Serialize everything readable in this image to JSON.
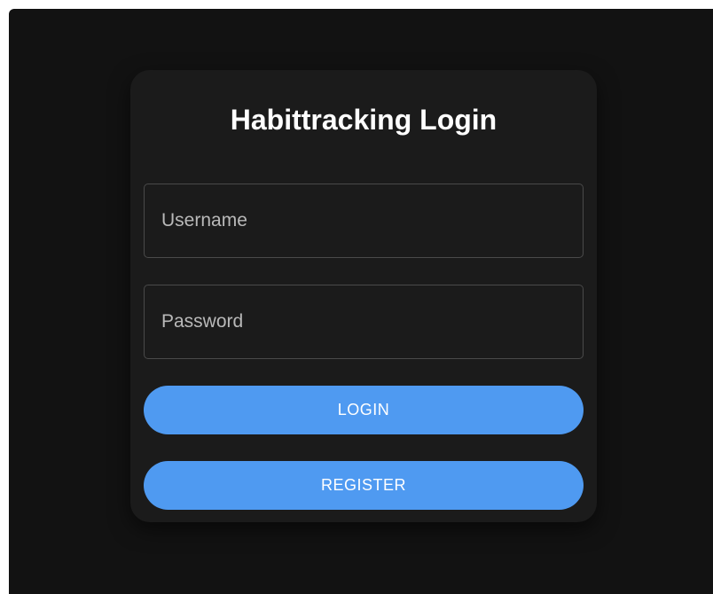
{
  "login": {
    "title": "Habittracking Login",
    "username_placeholder": "Username",
    "password_placeholder": "Password",
    "login_label": "LOGIN",
    "register_label": "REGISTER"
  },
  "colors": {
    "background": "#121212",
    "card": "#1b1b1b",
    "accent": "#4f9af1",
    "text": "#ffffff"
  }
}
